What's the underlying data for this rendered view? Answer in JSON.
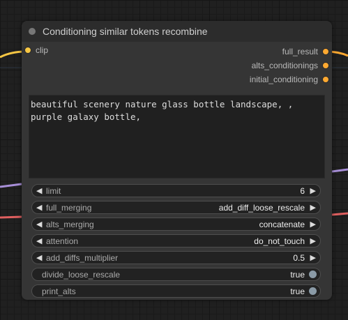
{
  "node": {
    "title": "Conditioning similar tokens recombine",
    "inputs": [
      {
        "label": "clip"
      }
    ],
    "outputs": [
      {
        "label": "full_result"
      },
      {
        "label": "alts_conditionings"
      },
      {
        "label": "initial_conditioning"
      }
    ],
    "prompt_text": "beautiful scenery nature glass bottle landscape, , purple galaxy bottle,",
    "widgets": [
      {
        "label": "limit",
        "value": "6"
      },
      {
        "label": "full_merging",
        "value": "add_diff_loose_rescale"
      },
      {
        "label": "alts_merging",
        "value": "concatenate"
      },
      {
        "label": "attention",
        "value": "do_not_touch"
      },
      {
        "label": "add_diffs_multiplier",
        "value": "0.5"
      }
    ],
    "toggles": [
      {
        "label": "divide_loose_rescale",
        "value": "true"
      },
      {
        "label": "print_alts",
        "value": "true"
      }
    ],
    "arrow_left": "◀",
    "arrow_right": "▶"
  },
  "colors": {
    "clip_slot": "#f7c744",
    "conditioning_slot": "#ffa931",
    "wire_clip": "#f7c744",
    "wire_purple": "#a88fd8",
    "wire_red": "#e06060",
    "toggle_knob": "#8a9aa6"
  }
}
